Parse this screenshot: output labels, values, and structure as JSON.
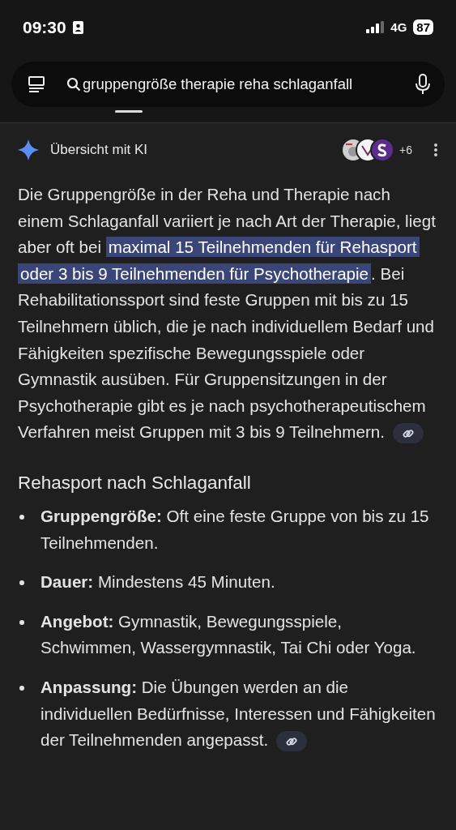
{
  "status_bar": {
    "time": "09:30",
    "network": "4G",
    "battery": "87"
  },
  "search": {
    "query": "gruppengröße therapie reha schlaganfall"
  },
  "overview": {
    "title": "Übersicht mit KI",
    "sources_more": "+6",
    "paragraph": [
      {
        "text": "Die Gruppengröße in der Reha und Therapie nach einem Schlaganfall variiert je nach Art der Therapie, liegt aber oft bei ",
        "highlighted": false
      },
      {
        "text": "maximal 15 Teilnehmenden für Rehasport oder 3 bis 9 Teilnehmenden für Psychotherapie",
        "highlighted": true
      },
      {
        "text": ". Bei Rehabilitationssport sind feste Gruppen mit bis zu 15 Teilnehmern üblich, die je nach individuellem Bedarf und Fähigkeiten spezifische Bewegungsspiele oder Gymnastik ausüben. Für Gruppensitzungen in der Psychotherapie gibt es je nach psychotherapeutischem Verfahren meist Gruppen mit 3 bis 9 Teilnehmern.",
        "highlighted": false
      }
    ],
    "heading": "Rehasport nach Schlaganfall",
    "bullets": [
      {
        "label": "Gruppengröße:",
        "text": "Oft eine feste Gruppe von bis zu 15 Teilnehmenden.",
        "link": false
      },
      {
        "label": "Dauer:",
        "text": "Mindestens 45 Minuten.",
        "link": false
      },
      {
        "label": "Angebot:",
        "text": "Gymnastik, Bewegungsspiele, Schwimmen, Wassergymnastik, Tai Chi oder Yoga.",
        "link": false
      },
      {
        "label": "Anpassung:",
        "text": "Die Übungen werden an die individuellen Bedürfnisse, Interessen und Fähigkeiten der Teilnehmenden angepasst.",
        "link": true
      }
    ]
  }
}
